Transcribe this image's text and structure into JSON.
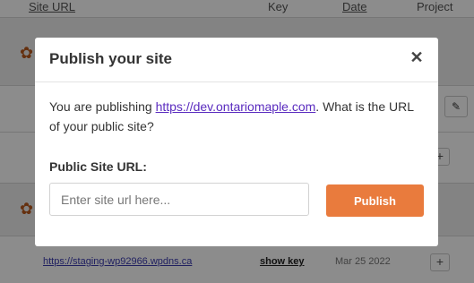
{
  "table": {
    "headers": {
      "site_url": "Site URL",
      "key": "Key",
      "date": "Date",
      "project": "Project"
    },
    "rows": [
      {
        "url": "https://staging-wp92966.wpdns.ca",
        "key": "show key",
        "date": "Mar 25 2022",
        "action": "+"
      }
    ]
  },
  "modal": {
    "title": "Publish your site",
    "close_glyph": "✕",
    "message_prefix": "You are publishing ",
    "message_link": "https://dev.ontariomaple.com",
    "message_suffix": ". What is the URL of your public site?",
    "field_label": "Public Site URL:",
    "input_placeholder": "Enter site url here...",
    "input_value": "",
    "publish_label": "Publish"
  },
  "icons": {
    "gear": "gear-icon",
    "pencil": "pencil-icon",
    "plus": "plus-icon",
    "close": "close-icon"
  },
  "colors": {
    "accent": "#e97b3d",
    "link": "#5a2bbf",
    "gear": "#b8581c"
  }
}
